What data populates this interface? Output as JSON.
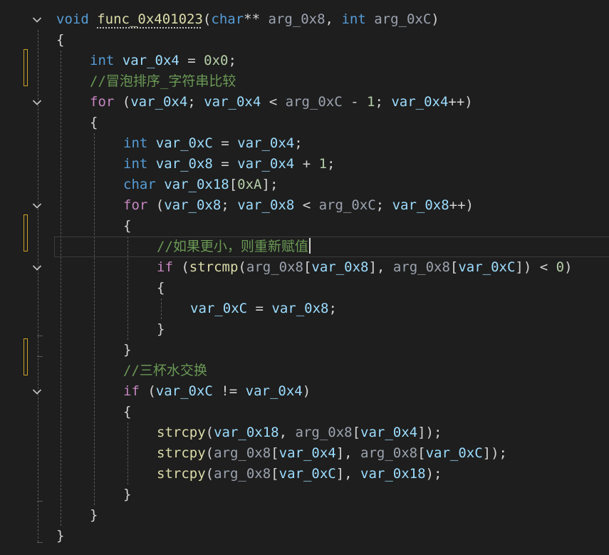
{
  "editor": {
    "lines": [
      {
        "indent": 0,
        "fold": true,
        "tokens": [
          {
            "t": "void ",
            "c": "k"
          },
          {
            "t": "func_0x401023",
            "c": "f",
            "u": true
          },
          {
            "t": "(",
            "c": "t"
          },
          {
            "t": "char",
            "c": "k"
          },
          {
            "t": "** ",
            "c": "t"
          },
          {
            "t": "arg_0x8",
            "c": "p"
          },
          {
            "t": ", ",
            "c": "t"
          },
          {
            "t": "int ",
            "c": "k"
          },
          {
            "t": "arg_0xC",
            "c": "p"
          },
          {
            "t": ")",
            "c": "t"
          }
        ]
      },
      {
        "indent": 0,
        "tokens": [
          {
            "t": "{",
            "c": "t"
          }
        ]
      },
      {
        "indent": 1,
        "tokens": [
          {
            "t": "int ",
            "c": "k"
          },
          {
            "t": "var_0x4",
            "c": "v"
          },
          {
            "t": " = ",
            "c": "t"
          },
          {
            "t": "0x0",
            "c": "n"
          },
          {
            "t": ";",
            "c": "t"
          }
        ]
      },
      {
        "indent": 1,
        "tokens": [
          {
            "t": "//冒泡排序_字符串比较",
            "c": "c"
          }
        ]
      },
      {
        "indent": 1,
        "fold": true,
        "tokens": [
          {
            "t": "for ",
            "c": "kc"
          },
          {
            "t": "(",
            "c": "t"
          },
          {
            "t": "var_0x4",
            "c": "v"
          },
          {
            "t": "; ",
            "c": "t"
          },
          {
            "t": "var_0x4",
            "c": "v"
          },
          {
            "t": " < ",
            "c": "t"
          },
          {
            "t": "arg_0xC",
            "c": "p"
          },
          {
            "t": " - ",
            "c": "t"
          },
          {
            "t": "1",
            "c": "n"
          },
          {
            "t": "; ",
            "c": "t"
          },
          {
            "t": "var_0x4",
            "c": "v"
          },
          {
            "t": "++)",
            "c": "t"
          }
        ]
      },
      {
        "indent": 1,
        "tokens": [
          {
            "t": "{",
            "c": "t"
          }
        ]
      },
      {
        "indent": 2,
        "tokens": [
          {
            "t": "int ",
            "c": "k"
          },
          {
            "t": "var_0xC",
            "c": "v"
          },
          {
            "t": " = ",
            "c": "t"
          },
          {
            "t": "var_0x4",
            "c": "v"
          },
          {
            "t": ";",
            "c": "t"
          }
        ]
      },
      {
        "indent": 2,
        "tokens": [
          {
            "t": "int ",
            "c": "k"
          },
          {
            "t": "var_0x8",
            "c": "v"
          },
          {
            "t": " = ",
            "c": "t"
          },
          {
            "t": "var_0x4",
            "c": "v"
          },
          {
            "t": " + ",
            "c": "t"
          },
          {
            "t": "1",
            "c": "n"
          },
          {
            "t": ";",
            "c": "t"
          }
        ]
      },
      {
        "indent": 2,
        "tokens": [
          {
            "t": "char ",
            "c": "k"
          },
          {
            "t": "var_0x18",
            "c": "v"
          },
          {
            "t": "[",
            "c": "t"
          },
          {
            "t": "0xA",
            "c": "n"
          },
          {
            "t": "];",
            "c": "t"
          }
        ]
      },
      {
        "indent": 2,
        "fold": true,
        "tokens": [
          {
            "t": "for ",
            "c": "kc"
          },
          {
            "t": "(",
            "c": "t"
          },
          {
            "t": "var_0x8",
            "c": "v"
          },
          {
            "t": "; ",
            "c": "t"
          },
          {
            "t": "var_0x8",
            "c": "v"
          },
          {
            "t": " < ",
            "c": "t"
          },
          {
            "t": "arg_0xC",
            "c": "p"
          },
          {
            "t": "; ",
            "c": "t"
          },
          {
            "t": "var_0x8",
            "c": "v"
          },
          {
            "t": "++)",
            "c": "t"
          }
        ]
      },
      {
        "indent": 2,
        "tokens": [
          {
            "t": "{",
            "c": "t"
          }
        ]
      },
      {
        "indent": 3,
        "current": true,
        "tokens": [
          {
            "t": "//如果更小，则重新赋值",
            "c": "c"
          }
        ]
      },
      {
        "indent": 3,
        "fold": true,
        "tokens": [
          {
            "t": "if ",
            "c": "kc"
          },
          {
            "t": "(",
            "c": "t"
          },
          {
            "t": "strcmp",
            "c": "f"
          },
          {
            "t": "(",
            "c": "t"
          },
          {
            "t": "arg_0x8",
            "c": "p"
          },
          {
            "t": "[",
            "c": "t"
          },
          {
            "t": "var_0x8",
            "c": "v"
          },
          {
            "t": "], ",
            "c": "t"
          },
          {
            "t": "arg_0x8",
            "c": "p"
          },
          {
            "t": "[",
            "c": "t"
          },
          {
            "t": "var_0xC",
            "c": "v"
          },
          {
            "t": "]) < ",
            "c": "t"
          },
          {
            "t": "0",
            "c": "n"
          },
          {
            "t": ")",
            "c": "t"
          }
        ]
      },
      {
        "indent": 3,
        "tokens": [
          {
            "t": "{",
            "c": "t"
          }
        ]
      },
      {
        "indent": 4,
        "tokens": [
          {
            "t": "var_0xC",
            "c": "v"
          },
          {
            "t": " = ",
            "c": "t"
          },
          {
            "t": "var_0x8",
            "c": "v"
          },
          {
            "t": ";",
            "c": "t"
          }
        ]
      },
      {
        "indent": 3,
        "tokens": [
          {
            "t": "}",
            "c": "t"
          }
        ]
      },
      {
        "indent": 2,
        "tokens": [
          {
            "t": "}",
            "c": "t"
          }
        ]
      },
      {
        "indent": 2,
        "tokens": [
          {
            "t": "//三杯水交换",
            "c": "c"
          }
        ]
      },
      {
        "indent": 2,
        "fold": true,
        "tokens": [
          {
            "t": "if ",
            "c": "kc"
          },
          {
            "t": "(",
            "c": "t"
          },
          {
            "t": "var_0xC",
            "c": "v"
          },
          {
            "t": " != ",
            "c": "t"
          },
          {
            "t": "var_0x4",
            "c": "v"
          },
          {
            "t": ")",
            "c": "t"
          }
        ]
      },
      {
        "indent": 2,
        "tokens": [
          {
            "t": "{",
            "c": "t"
          }
        ]
      },
      {
        "indent": 3,
        "tokens": [
          {
            "t": "strcpy",
            "c": "f"
          },
          {
            "t": "(",
            "c": "t"
          },
          {
            "t": "var_0x18",
            "c": "v"
          },
          {
            "t": ", ",
            "c": "t"
          },
          {
            "t": "arg_0x8",
            "c": "p"
          },
          {
            "t": "[",
            "c": "t"
          },
          {
            "t": "var_0x4",
            "c": "v"
          },
          {
            "t": "]);",
            "c": "t"
          }
        ]
      },
      {
        "indent": 3,
        "tokens": [
          {
            "t": "strcpy",
            "c": "f"
          },
          {
            "t": "(",
            "c": "t"
          },
          {
            "t": "arg_0x8",
            "c": "p"
          },
          {
            "t": "[",
            "c": "t"
          },
          {
            "t": "var_0x4",
            "c": "v"
          },
          {
            "t": "], ",
            "c": "t"
          },
          {
            "t": "arg_0x8",
            "c": "p"
          },
          {
            "t": "[",
            "c": "t"
          },
          {
            "t": "var_0xC",
            "c": "v"
          },
          {
            "t": "]);",
            "c": "t"
          }
        ]
      },
      {
        "indent": 3,
        "tokens": [
          {
            "t": "strcpy",
            "c": "f"
          },
          {
            "t": "(",
            "c": "t"
          },
          {
            "t": "arg_0x8",
            "c": "p"
          },
          {
            "t": "[",
            "c": "t"
          },
          {
            "t": "var_0xC",
            "c": "v"
          },
          {
            "t": "], ",
            "c": "t"
          },
          {
            "t": "var_0x18",
            "c": "v"
          },
          {
            "t": ");",
            "c": "t"
          }
        ]
      },
      {
        "indent": 2,
        "tokens": [
          {
            "t": "}",
            "c": "t"
          }
        ]
      },
      {
        "indent": 1,
        "tokens": [
          {
            "t": "}",
            "c": "t"
          }
        ]
      },
      {
        "indent": 0,
        "tokens": [
          {
            "t": "}",
            "c": "t"
          }
        ]
      }
    ],
    "colors": {
      "background": "#1e1e1e",
      "keyword": "#569cd6",
      "control": "#c586c0",
      "function": "#dcdcaa",
      "variable": "#9cdcfe",
      "parameter": "#9ca3af",
      "number": "#b5cea8",
      "comment": "#6a9955",
      "text": "#d4d4d4",
      "change_marker": "#c9a227"
    },
    "fold_icon": "chevron-down-icon"
  }
}
